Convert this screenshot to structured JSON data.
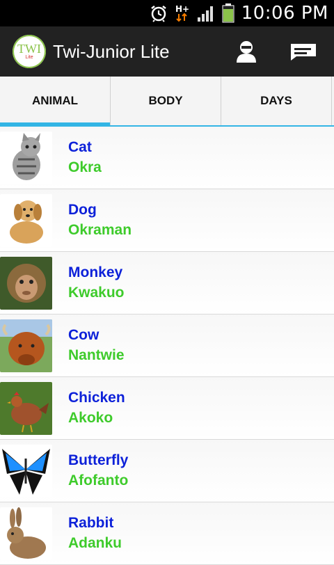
{
  "status_bar": {
    "time": "10:06 PM",
    "network": "H+"
  },
  "app": {
    "title": "Twi-Junior Lite",
    "logo_text": "TWI",
    "logo_sub": "Lite"
  },
  "tabs": [
    {
      "label": "ANIMAL",
      "active": true
    },
    {
      "label": "BODY",
      "active": false
    },
    {
      "label": "DAYS",
      "active": false
    }
  ],
  "items": [
    {
      "english": "Cat",
      "twi": "Okra",
      "icon": "cat-image"
    },
    {
      "english": "Dog",
      "twi": "Okraman",
      "icon": "dog-image"
    },
    {
      "english": "Monkey",
      "twi": "Kwakuo",
      "icon": "monkey-image"
    },
    {
      "english": "Cow",
      "twi": "Nantwie",
      "icon": "cow-image"
    },
    {
      "english": "Chicken",
      "twi": "Akoko",
      "icon": "chicken-image"
    },
    {
      "english": "Butterfly",
      "twi": "Afofanto",
      "icon": "butterfly-image"
    },
    {
      "english": "Rabbit",
      "twi": "Adanku",
      "icon": "rabbit-image"
    }
  ]
}
